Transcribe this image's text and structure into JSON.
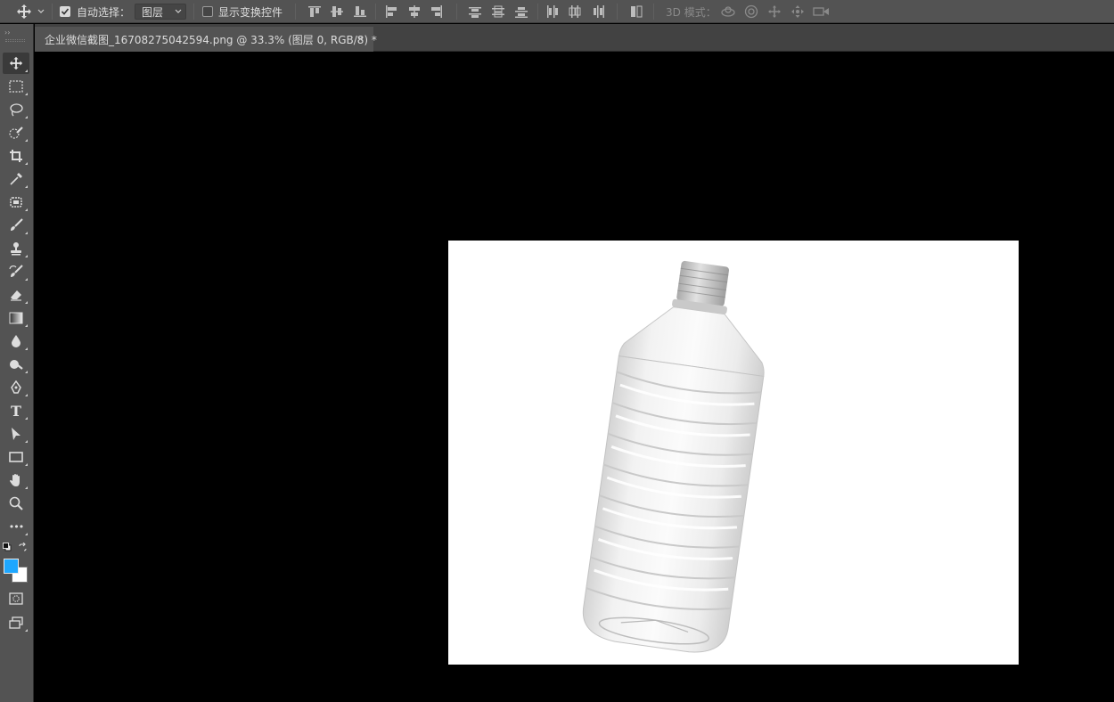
{
  "options_bar": {
    "auto_select_label": "自动选择：",
    "auto_select_checked": true,
    "auto_select_value": "图层",
    "show_transform_label": "显示变换控件",
    "show_transform_checked": false,
    "mode_3d_label": "3D 模式："
  },
  "document": {
    "tab_title": "企业微信截图_16708275042594.png @ 33.3% (图层 0, RGB/8) *",
    "close_glyph": "×",
    "background": "#ffffff"
  },
  "toolbox": {
    "tools": [
      {
        "name": "move-tool",
        "icon": "move-icon"
      },
      {
        "name": "rectangular-marquee-tool",
        "icon": "marquee-icon"
      },
      {
        "name": "lasso-tool",
        "icon": "lasso-icon"
      },
      {
        "name": "quick-selection-tool",
        "icon": "quick-selection-icon"
      },
      {
        "name": "crop-tool",
        "icon": "crop-icon"
      },
      {
        "name": "eyedropper-tool",
        "icon": "eyedropper-icon"
      },
      {
        "name": "spot-healing-tool",
        "icon": "healing-icon"
      },
      {
        "name": "brush-tool",
        "icon": "brush-icon"
      },
      {
        "name": "clone-stamp-tool",
        "icon": "stamp-icon"
      },
      {
        "name": "history-brush-tool",
        "icon": "history-brush-icon"
      },
      {
        "name": "eraser-tool",
        "icon": "eraser-icon"
      },
      {
        "name": "gradient-tool",
        "icon": "gradient-icon"
      },
      {
        "name": "blur-tool",
        "icon": "blur-icon"
      },
      {
        "name": "dodge-tool",
        "icon": "dodge-icon"
      },
      {
        "name": "pen-tool",
        "icon": "pen-icon"
      },
      {
        "name": "type-tool",
        "icon": "type-icon"
      },
      {
        "name": "path-selection-tool",
        "icon": "path-selection-icon"
      },
      {
        "name": "rectangle-tool",
        "icon": "rectangle-icon"
      },
      {
        "name": "hand-tool",
        "icon": "hand-icon"
      },
      {
        "name": "zoom-tool",
        "icon": "zoom-icon"
      },
      {
        "name": "edit-toolbar",
        "icon": "more-icon"
      }
    ],
    "type_glyph": "T",
    "more_glyph": "•••",
    "foreground_color": "#1ea7ff",
    "background_color": "#ffffff"
  },
  "colors": {
    "panel": "#535353",
    "canvas": "#000000"
  }
}
